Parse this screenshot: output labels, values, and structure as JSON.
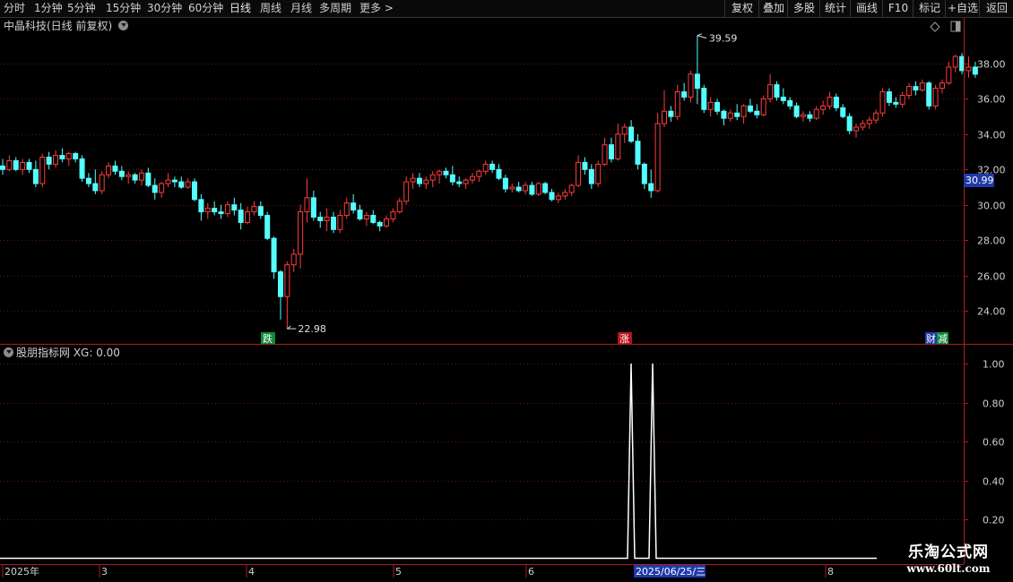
{
  "periods": [
    "分时",
    "1分钟",
    "5分钟",
    "15分钟",
    "30分钟",
    "60分钟",
    "日线",
    "周线",
    "月线",
    "多周期",
    "更多 >"
  ],
  "active_period": "日线",
  "right_buttons": [
    "复权",
    "叠加",
    "多股",
    "统计",
    "画线",
    "F10",
    "标记",
    "+自选",
    "返回"
  ],
  "stock_title": "中晶科技(日线 前复权)",
  "indicator_title": "股朋指标网  XG: 0.00",
  "price_axis": {
    "labels": [
      "38.00",
      "36.00",
      "34.00",
      "32.00",
      "30.00",
      "28.00",
      "26.00",
      "24.00"
    ],
    "current_price": "30.99"
  },
  "annotations": {
    "high": "39.59",
    "low": "22.98"
  },
  "signals": [
    "跌",
    "涨",
    "财",
    "减"
  ],
  "indicator_axis": {
    "labels": [
      "1.00",
      "0.80",
      "0.60",
      "0.40",
      "0.20"
    ]
  },
  "date_axis": [
    "2025年",
    "3",
    "4",
    "5",
    "6",
    "8"
  ],
  "cursor_date": "2025/06/25/三",
  "watermark": {
    "line1": "乐淘公式网",
    "line2": "www.60lt.com"
  },
  "colors": {
    "up": "#ff3c3c",
    "down": "#54ffff",
    "grid": "#6b1010",
    "axis": "#b01c1c"
  },
  "chart_data": {
    "type": "candlestick",
    "ylim": [
      22.0,
      41.0
    ],
    "candles": [
      [
        32.2,
        32.6,
        31.7,
        32.0
      ],
      [
        32.0,
        32.8,
        31.9,
        32.5
      ],
      [
        32.5,
        32.7,
        31.9,
        32.0
      ],
      [
        32.0,
        32.6,
        31.7,
        32.4
      ],
      [
        32.4,
        32.6,
        31.8,
        32.0
      ],
      [
        32.0,
        32.5,
        31.0,
        31.2
      ],
      [
        31.2,
        32.9,
        31.0,
        32.7
      ],
      [
        32.7,
        33.0,
        32.0,
        32.3
      ],
      [
        32.3,
        33.1,
        32.1,
        32.8
      ],
      [
        32.8,
        33.2,
        32.4,
        32.6
      ],
      [
        32.6,
        33.0,
        32.2,
        32.9
      ],
      [
        32.9,
        33.0,
        32.4,
        32.6
      ],
      [
        32.6,
        32.8,
        31.3,
        31.5
      ],
      [
        31.5,
        31.8,
        31.0,
        31.2
      ],
      [
        31.2,
        32.0,
        30.6,
        30.8
      ],
      [
        30.8,
        31.9,
        30.6,
        31.7
      ],
      [
        31.7,
        32.4,
        31.5,
        32.2
      ],
      [
        32.2,
        32.5,
        31.7,
        31.9
      ],
      [
        31.9,
        32.2,
        31.4,
        31.6
      ],
      [
        31.6,
        31.9,
        31.2,
        31.7
      ],
      [
        31.7,
        31.8,
        31.2,
        31.4
      ],
      [
        31.4,
        32.0,
        31.1,
        31.8
      ],
      [
        31.8,
        32.1,
        31.0,
        31.1
      ],
      [
        31.1,
        31.5,
        30.3,
        30.7
      ],
      [
        30.7,
        31.3,
        30.4,
        31.2
      ],
      [
        31.2,
        31.8,
        31.0,
        31.4
      ],
      [
        31.4,
        31.6,
        31.0,
        31.3
      ],
      [
        31.3,
        31.6,
        30.9,
        31.0
      ],
      [
        31.0,
        31.5,
        30.9,
        31.3
      ],
      [
        31.3,
        31.5,
        30.2,
        30.3
      ],
      [
        30.3,
        30.6,
        29.1,
        29.6
      ],
      [
        29.6,
        30.1,
        29.2,
        29.8
      ],
      [
        29.8,
        30.2,
        29.4,
        29.6
      ],
      [
        29.6,
        30.0,
        29.2,
        29.5
      ],
      [
        29.5,
        30.2,
        29.3,
        30.0
      ],
      [
        30.0,
        30.4,
        29.4,
        29.7
      ],
      [
        29.7,
        30.1,
        28.6,
        29.0
      ],
      [
        29.0,
        29.9,
        28.9,
        29.6
      ],
      [
        29.6,
        30.2,
        29.4,
        29.9
      ],
      [
        29.9,
        30.2,
        29.2,
        29.4
      ],
      [
        29.4,
        29.6,
        28.0,
        28.1
      ],
      [
        28.1,
        28.2,
        25.8,
        26.2
      ],
      [
        26.2,
        26.3,
        23.5,
        24.8
      ],
      [
        24.8,
        26.8,
        22.98,
        26.6
      ],
      [
        26.6,
        27.5,
        26.2,
        27.2
      ],
      [
        27.2,
        30.0,
        26.4,
        29.6
      ],
      [
        29.6,
        31.5,
        29.0,
        30.4
      ],
      [
        30.4,
        30.8,
        29.1,
        29.3
      ],
      [
        29.3,
        29.6,
        28.7,
        29.1
      ],
      [
        29.1,
        29.8,
        28.5,
        29.3
      ],
      [
        29.3,
        29.6,
        28.4,
        28.6
      ],
      [
        28.6,
        29.7,
        28.4,
        29.4
      ],
      [
        29.4,
        30.4,
        29.2,
        30.1
      ],
      [
        30.1,
        30.6,
        29.5,
        29.7
      ],
      [
        29.7,
        30.0,
        29.1,
        29.2
      ],
      [
        29.2,
        29.6,
        28.8,
        29.4
      ],
      [
        29.4,
        29.7,
        28.9,
        29.0
      ],
      [
        29.0,
        29.1,
        28.5,
        28.8
      ],
      [
        28.8,
        29.4,
        28.7,
        29.2
      ],
      [
        29.2,
        29.8,
        29.0,
        29.6
      ],
      [
        29.6,
        30.4,
        29.5,
        30.2
      ],
      [
        30.2,
        31.6,
        30.0,
        31.3
      ],
      [
        31.3,
        31.8,
        30.9,
        31.5
      ],
      [
        31.5,
        31.8,
        31.0,
        31.2
      ],
      [
        31.2,
        31.6,
        30.9,
        31.4
      ],
      [
        31.4,
        31.9,
        31.0,
        31.7
      ],
      [
        31.7,
        32.0,
        31.2,
        31.9
      ],
      [
        31.9,
        32.1,
        31.5,
        31.7
      ],
      [
        31.7,
        32.2,
        31.1,
        31.3
      ],
      [
        31.3,
        31.6,
        31.0,
        31.2
      ],
      [
        31.2,
        31.5,
        30.9,
        31.4
      ],
      [
        31.4,
        31.8,
        31.2,
        31.6
      ],
      [
        31.6,
        32.0,
        31.3,
        31.9
      ],
      [
        31.9,
        32.5,
        31.7,
        32.3
      ],
      [
        32.3,
        32.5,
        31.8,
        32.0
      ],
      [
        32.0,
        32.3,
        31.4,
        31.5
      ],
      [
        31.5,
        31.7,
        30.7,
        30.9
      ],
      [
        30.9,
        31.2,
        30.7,
        31.0
      ],
      [
        31.0,
        31.3,
        30.7,
        30.8
      ],
      [
        30.8,
        31.3,
        30.6,
        31.1
      ],
      [
        31.1,
        31.3,
        30.5,
        30.6
      ],
      [
        30.6,
        31.3,
        30.5,
        31.2
      ],
      [
        31.2,
        31.3,
        30.6,
        30.7
      ],
      [
        30.7,
        30.9,
        30.2,
        30.3
      ],
      [
        30.3,
        30.7,
        30.1,
        30.5
      ],
      [
        30.5,
        30.9,
        30.3,
        30.7
      ],
      [
        30.7,
        31.2,
        30.5,
        31.1
      ],
      [
        31.1,
        32.8,
        31.0,
        32.4
      ],
      [
        32.4,
        32.7,
        31.7,
        32.0
      ],
      [
        32.0,
        32.3,
        30.9,
        31.2
      ],
      [
        31.2,
        32.5,
        31.0,
        32.3
      ],
      [
        32.3,
        33.8,
        32.2,
        33.4
      ],
      [
        33.4,
        33.8,
        32.4,
        32.6
      ],
      [
        32.6,
        34.6,
        32.5,
        34.0
      ],
      [
        34.0,
        34.6,
        33.5,
        34.4
      ],
      [
        34.4,
        34.8,
        33.5,
        33.6
      ],
      [
        33.6,
        34.0,
        32.0,
        32.3
      ],
      [
        32.3,
        32.4,
        30.9,
        31.2
      ],
      [
        31.2,
        32.0,
        30.4,
        30.8
      ],
      [
        30.8,
        35.2,
        30.7,
        34.6
      ],
      [
        34.6,
        36.5,
        34.4,
        35.3
      ],
      [
        35.3,
        35.6,
        34.7,
        35.0
      ],
      [
        35.0,
        36.8,
        34.8,
        36.4
      ],
      [
        36.4,
        36.9,
        35.9,
        36.1
      ],
      [
        36.1,
        37.6,
        35.8,
        37.4
      ],
      [
        37.4,
        39.59,
        35.7,
        36.6
      ],
      [
        36.6,
        36.8,
        35.2,
        35.4
      ],
      [
        35.4,
        36.1,
        35.0,
        35.8
      ],
      [
        35.8,
        36.0,
        35.1,
        35.3
      ],
      [
        35.3,
        35.4,
        34.5,
        34.9
      ],
      [
        34.9,
        35.4,
        34.7,
        35.2
      ],
      [
        35.2,
        35.7,
        34.8,
        35.0
      ],
      [
        35.0,
        35.7,
        34.6,
        35.6
      ],
      [
        35.6,
        36.0,
        35.2,
        35.3
      ],
      [
        35.3,
        35.7,
        34.9,
        35.1
      ],
      [
        35.1,
        36.2,
        35.0,
        36.0
      ],
      [
        36.0,
        37.4,
        35.8,
        36.8
      ],
      [
        36.8,
        37.0,
        35.9,
        36.1
      ],
      [
        36.1,
        36.6,
        35.7,
        35.9
      ],
      [
        35.9,
        36.1,
        35.4,
        35.6
      ],
      [
        35.6,
        35.8,
        34.9,
        35.0
      ],
      [
        35.0,
        35.3,
        34.7,
        35.1
      ],
      [
        35.1,
        35.3,
        34.7,
        34.9
      ],
      [
        34.9,
        35.6,
        34.8,
        35.4
      ],
      [
        35.4,
        35.9,
        35.1,
        35.6
      ],
      [
        35.6,
        36.4,
        35.4,
        36.1
      ],
      [
        36.1,
        36.3,
        35.3,
        35.5
      ],
      [
        35.5,
        35.7,
        34.9,
        35.0
      ],
      [
        35.0,
        35.2,
        34.0,
        34.2
      ],
      [
        34.2,
        34.6,
        33.8,
        34.4
      ],
      [
        34.4,
        34.8,
        34.2,
        34.6
      ],
      [
        34.6,
        35.0,
        34.3,
        34.8
      ],
      [
        34.8,
        35.4,
        34.6,
        35.2
      ],
      [
        35.2,
        36.6,
        35.0,
        36.4
      ],
      [
        36.4,
        36.6,
        35.6,
        35.8
      ],
      [
        35.8,
        36.1,
        35.5,
        35.7
      ],
      [
        35.7,
        36.4,
        35.5,
        36.2
      ],
      [
        36.2,
        36.9,
        36.0,
        36.7
      ],
      [
        36.7,
        37.0,
        36.2,
        36.5
      ],
      [
        36.5,
        37.1,
        36.4,
        36.9
      ],
      [
        36.9,
        37.0,
        35.4,
        35.6
      ],
      [
        35.6,
        36.8,
        35.4,
        36.6
      ],
      [
        36.6,
        37.1,
        36.3,
        36.9
      ],
      [
        36.9,
        38.1,
        36.8,
        37.8
      ],
      [
        37.8,
        38.5,
        37.5,
        38.4
      ],
      [
        38.4,
        38.6,
        37.4,
        37.6
      ],
      [
        37.6,
        38.4,
        37.2,
        37.8
      ],
      [
        37.8,
        38.1,
        37.2,
        37.4
      ]
    ],
    "indicator": {
      "name": "XG",
      "ylim": [
        0,
        1.1
      ],
      "points": [
        [
          0,
          0
        ],
        [
          692,
          0
        ],
        [
          700,
          0
        ],
        [
          704,
          1
        ],
        [
          708,
          0
        ],
        [
          714,
          0
        ],
        [
          718,
          0
        ],
        [
          724,
          0
        ],
        [
          728,
          1
        ],
        [
          732,
          0
        ],
        [
          740,
          0
        ],
        [
          978,
          0
        ]
      ]
    }
  }
}
